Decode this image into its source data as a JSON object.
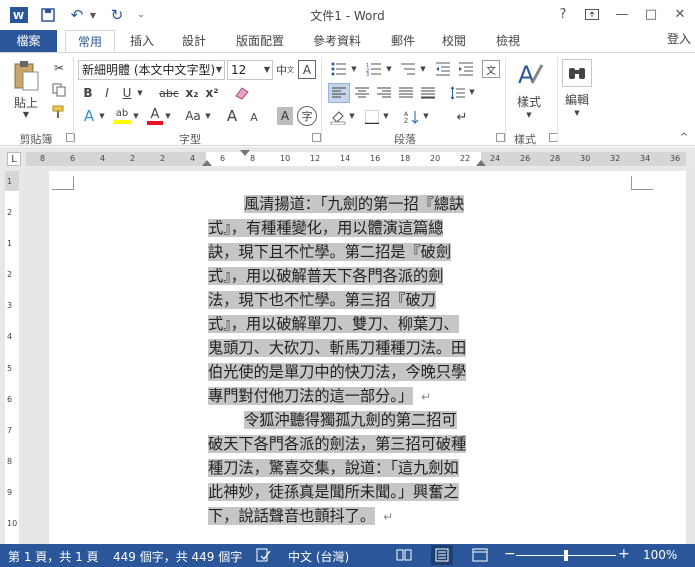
{
  "titlebar": {
    "title": "文件1 - Word",
    "help": "?",
    "minimize": "—",
    "restore": "□",
    "close": "✕"
  },
  "tabs": {
    "file": "檔案",
    "home": "常用",
    "insert": "插入",
    "design": "設計",
    "layout": "版面配置",
    "references": "參考資料",
    "mailings": "郵件",
    "review": "校閱",
    "view": "檢視",
    "signin": "登入"
  },
  "ribbon": {
    "paste_label": "貼上",
    "font_name": "新細明體 (本文中文字型)",
    "font_size": "12",
    "clipboard_group": "剪貼簿",
    "font_group": "字型",
    "paragraph_group": "段落",
    "styles_group": "樣式",
    "styles_label": "樣式",
    "editing_label": "編輯",
    "bold": "B",
    "italic": "I",
    "underline": "U",
    "strike": "abc",
    "subscript": "x₂",
    "superscript": "x²",
    "font_color": "A",
    "highlight": "ab",
    "grow": "A",
    "shrink": "A",
    "case": "Aa"
  },
  "ruler": {
    "numbers": [
      "8",
      "6",
      "4",
      "2",
      "2",
      "4",
      "6",
      "8",
      "10",
      "12",
      "14",
      "16",
      "18",
      "20",
      "22",
      "24",
      "26",
      "28",
      "30",
      "32",
      "34",
      "36"
    ]
  },
  "vruler": {
    "numbers": [
      "1",
      "2",
      "1",
      "2",
      "3",
      "4",
      "5",
      "6",
      "7",
      "8",
      "9",
      "10"
    ]
  },
  "document": {
    "lines": [
      "風清揚道：「九劍的第一招『總訣",
      "式』，有種種變化，用以體演這篇總",
      "訣，現下且不忙學。第二招是『破劍",
      "式』，用以破解普天下各門各派的劍",
      "法，現下也不忙學。第三招『破刀",
      "式』，用以破解單刀、雙刀、柳葉刀、",
      "鬼頭刀、大砍刀、斬馬刀種種刀法。田",
      "伯光使的是單刀中的快刀法，今晚只學",
      "專門對付他刀法的這一部分。」",
      "令狐沖聽得獨孤九劍的第二招可",
      "破天下各門各派的劍法，第三招可破種",
      "種刀法，驚喜交集，說道：「這九劍如",
      "此神妙，徒孫真是聞所未聞。」興奮之",
      "下，說話聲音也顫抖了。"
    ],
    "para_mark": "↵"
  },
  "status": {
    "page": "第 1 頁，共 1 頁",
    "words": "449 個字，共 449 個字",
    "language": "中文 (台灣)",
    "zoom": "100%",
    "zoom_level": 0.5
  },
  "colors": {
    "accent": "#2b579a",
    "selection": "#c6c6c6"
  }
}
